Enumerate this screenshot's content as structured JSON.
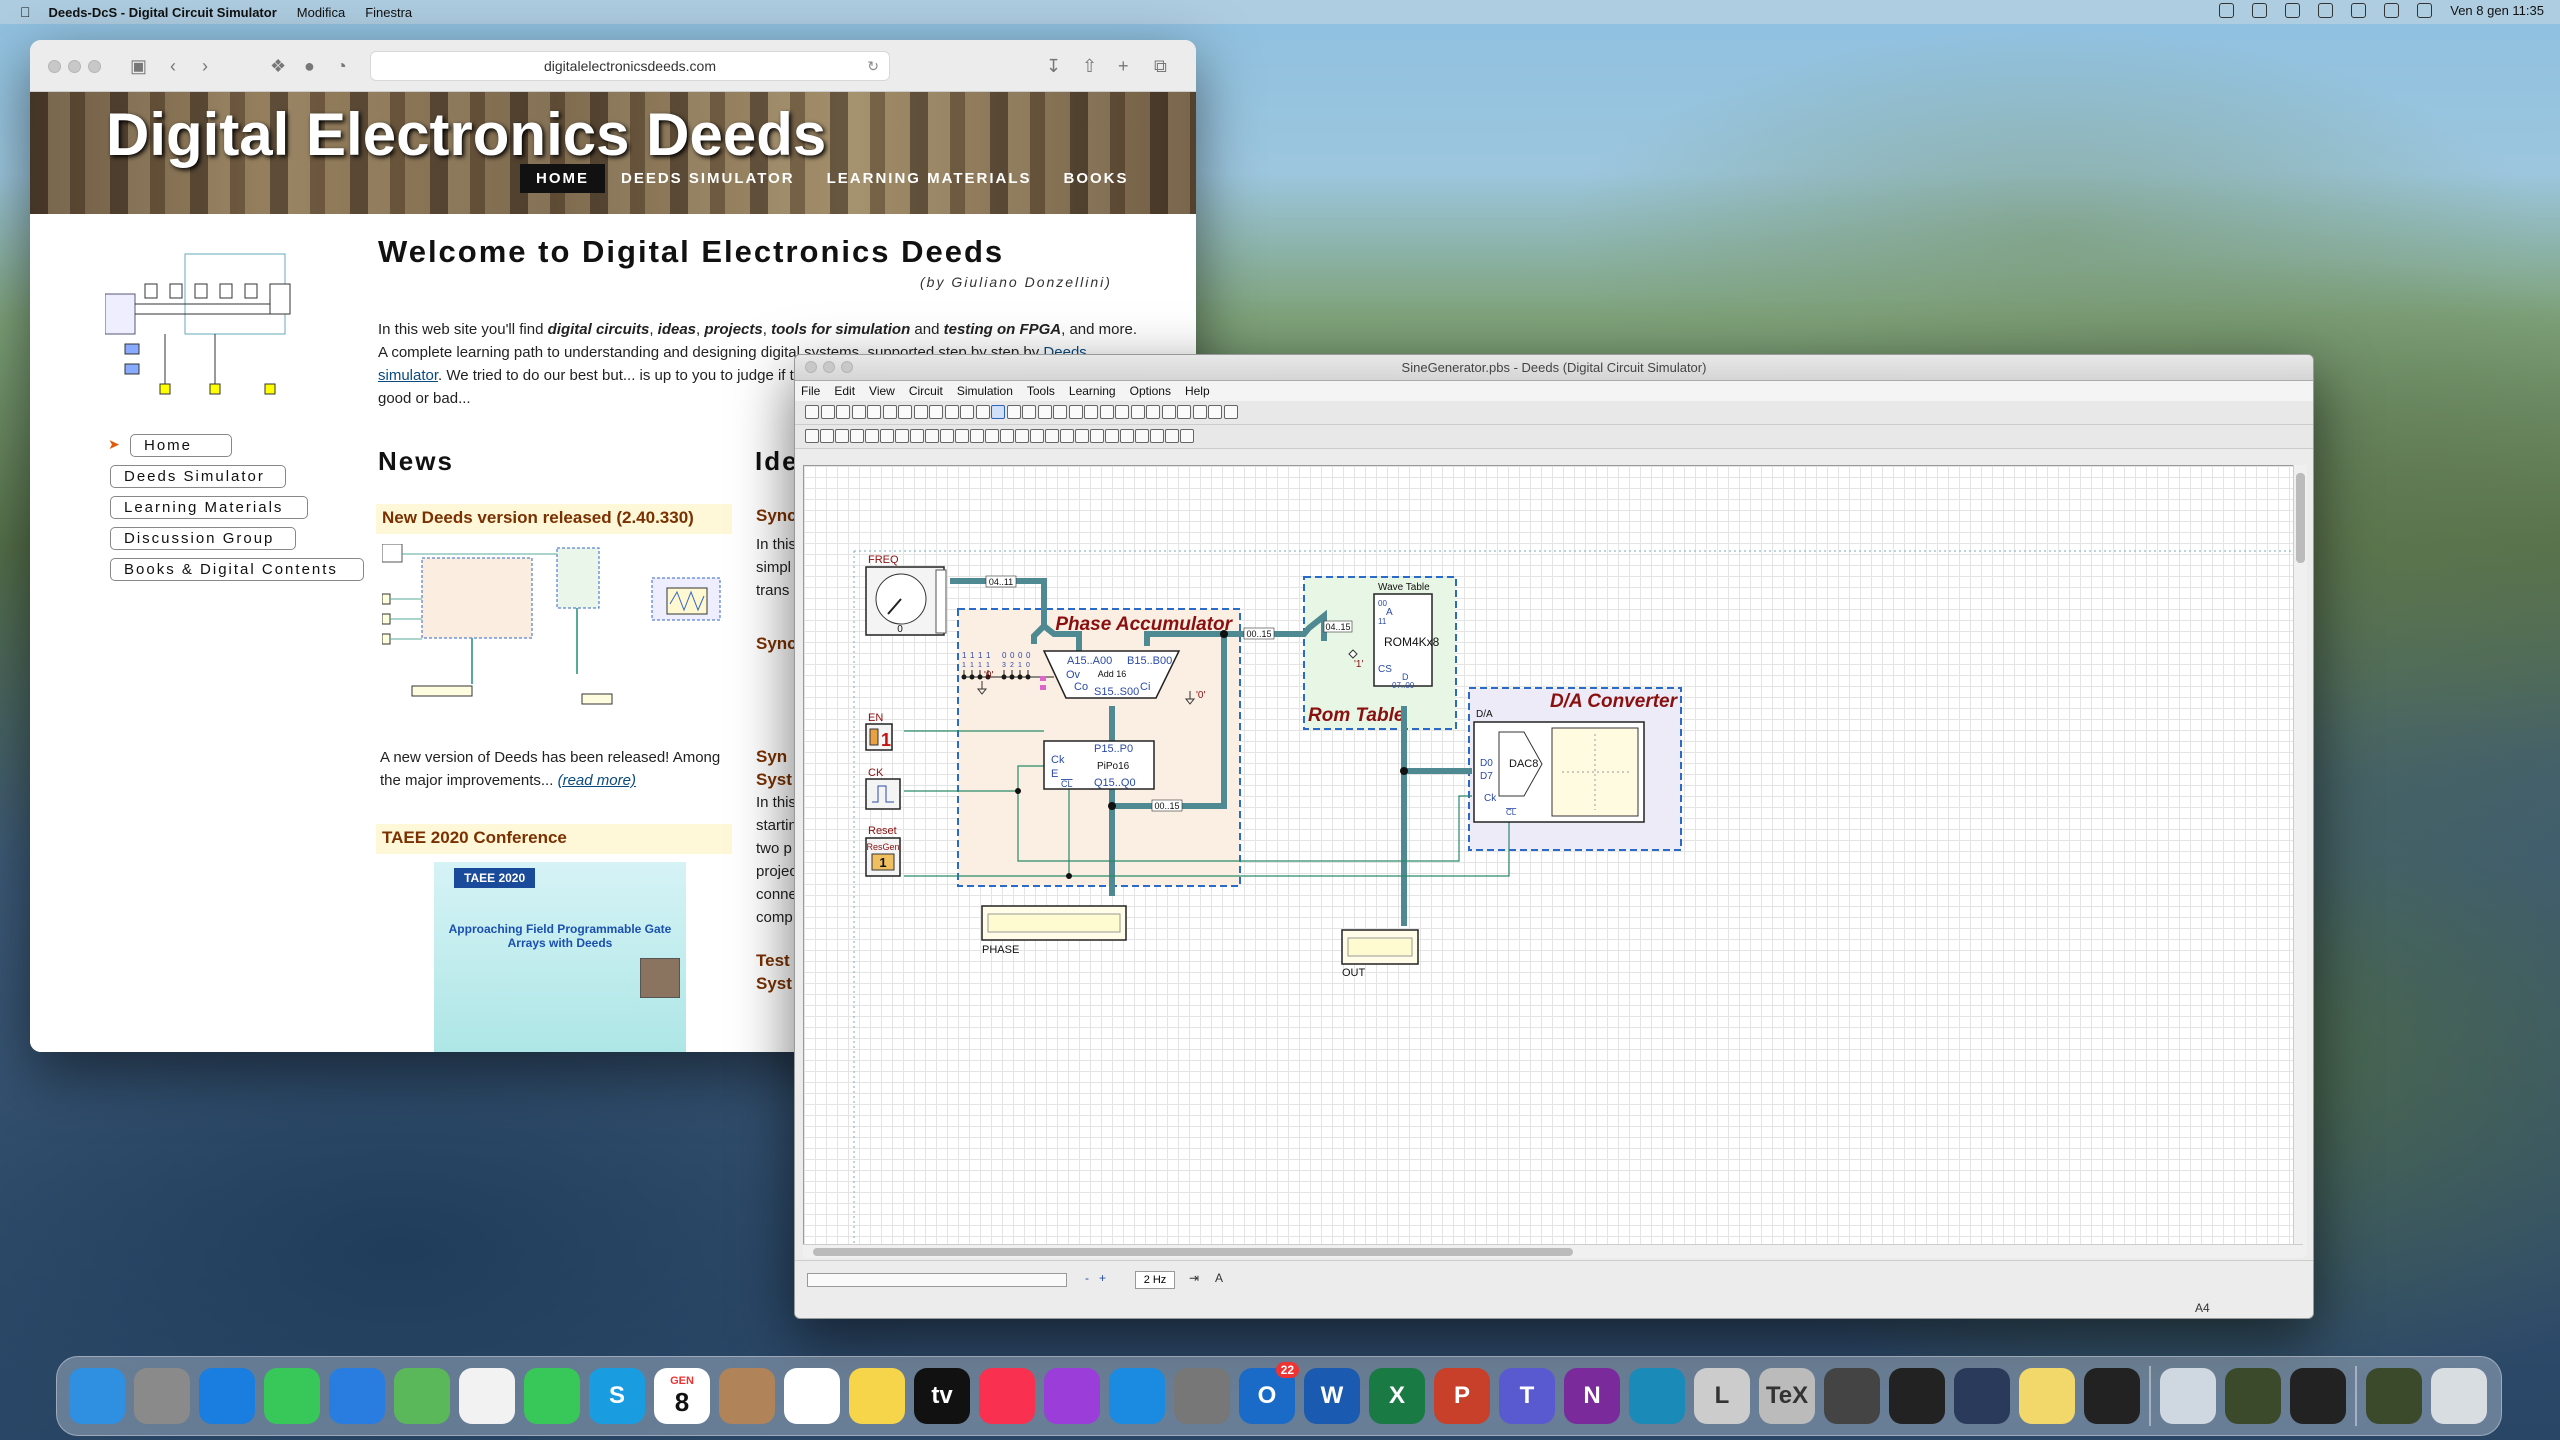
{
  "menubar": {
    "app_name": "Deeds-DcS - Digital Circuit Simulator",
    "menu_items": [
      "Modifica",
      "Finestra"
    ],
    "clock": "Ven 8 gen  11:35"
  },
  "safari": {
    "url": "digitalelectronicsdeeds.com",
    "site_title": "Digital Electronics Deeds",
    "nav": [
      "HOME",
      "DEEDS SIMULATOR",
      "LEARNING MATERIALS",
      "BOOKS"
    ],
    "side_menu": [
      "Home",
      "Deeds Simulator",
      "Learning Materials",
      "Discussion Group",
      "Books & Digital Contents"
    ],
    "welcome": "Welcome to Digital Electronics Deeds",
    "byline": "(by Giuliano Donzellini)",
    "intro_1": "In this web site you'll find ",
    "intro_em1": "digital circuits",
    "intro_em2": "ideas",
    "intro_em3": "projects",
    "intro_em4": "tools for simulation",
    "intro_and": " and ",
    "intro_em5": "testing on FPGA",
    "intro_2": ", and more. A complete learning path to understanding and designing digital systems, supported step by step by ",
    "intro_link": "Deeds simulator",
    "intro_3": ". We tried to do our best but... is up to you to judge if the contents (in the full meaning of the word!) are good or bad...",
    "news_heading": "News",
    "ideas_heading": "Ide",
    "news1_title": "New Deeds version released (2.40.330)",
    "news1_text": "A new version of Deeds has been released! Among the major improvements...",
    "news1_link": "(read more)",
    "news2_title": "TAEE 2020 Conference",
    "taee_label": "TAEE 2020",
    "taee_title": "Approaching Field Programmable Gate Arrays with Deeds",
    "ideas_items": [
      "Sync",
      "In this",
      "simpl",
      "trans",
      "Sync",
      "Syn",
      "Syst",
      "In this",
      "startin",
      "two p",
      "projec",
      "conne",
      "comp",
      "Test",
      "Syst"
    ]
  },
  "deeds": {
    "window_title": "SineGenerator.pbs - Deeds (Digital Circuit Simulator)",
    "menu": [
      "File",
      "Edit",
      "View",
      "Circuit",
      "Simulation",
      "Tools",
      "Learning",
      "Options",
      "Help"
    ],
    "speed": "2 Hz",
    "page_size": "A4",
    "circuit": {
      "freq_label": "FREQ",
      "freq_value": "0",
      "bus_freq": "04..11",
      "phase_acc_title": "Phase Accumulator",
      "rom_title": "Rom Table",
      "dac_title": "D/A Converter",
      "adder_label": "Add 16",
      "adder_a": "A15..A00",
      "adder_b": "B15..B00",
      "adder_s": "S15..S00",
      "adder_ov": "Ov",
      "adder_co": "Co",
      "adder_ci": "Ci",
      "zero": "'0'",
      "one": "'1'",
      "reg_label": "PiPo16",
      "reg_in": "P15..P0",
      "reg_out": "Q15..Q0",
      "reg_ck": "Ck",
      "reg_e": "E",
      "reg_cl": "CL",
      "bus_00_15": "00..15",
      "bus_04_15": "04..15",
      "rom_label": "ROM4Kx8",
      "rom_sub": "Wave Table",
      "rom_a": "A",
      "rom_a_lo": "00",
      "rom_a_hi": "11",
      "rom_cs": "CS",
      "rom_d": "D",
      "rom_d_range": "07..00",
      "dac_label": "DAC8",
      "dac_block": "D/A",
      "dac_d0": "D0",
      "dac_d7": "D7",
      "dac_ck": "Ck",
      "dac_cl": "CL",
      "en_label": "EN",
      "en_value": "1",
      "ck_label": "CK",
      "reset_label": "Reset",
      "resgen": "ResGen",
      "reset_value": "1",
      "phase_label": "PHASE",
      "out_label": "OUT",
      "bus_addr_bits": [
        "1",
        "1",
        "1",
        "1",
        "0",
        "0",
        "0",
        "0"
      ],
      "bus_addr_nums": [
        "1",
        "1",
        "1",
        "1",
        "3",
        "2",
        "1",
        "0"
      ]
    }
  },
  "dock": {
    "apps": [
      "Finder",
      "Launchpad",
      "Safari",
      "Messages",
      "Mail",
      "Maps",
      "Photos",
      "FaceTime",
      "Skype",
      "Calendar",
      "Contacts",
      "Reminders",
      "Notes",
      "TV",
      "Music",
      "Podcasts",
      "App Store",
      "System Preferences",
      "Outlook",
      "Word",
      "Excel",
      "PowerPoint",
      "Teams",
      "OneNote",
      "Edge",
      "LaTeXiT",
      "TeX",
      "Calculator",
      "Terminal",
      "Deeds",
      "Stickies",
      "Unknown",
      "Preview",
      "Deeds DcS",
      "Deeds FsM",
      "Deeds DcS 2",
      "Trash"
    ],
    "calendar_month": "GEN",
    "calendar_day": "8",
    "outlook_badge": "22"
  }
}
